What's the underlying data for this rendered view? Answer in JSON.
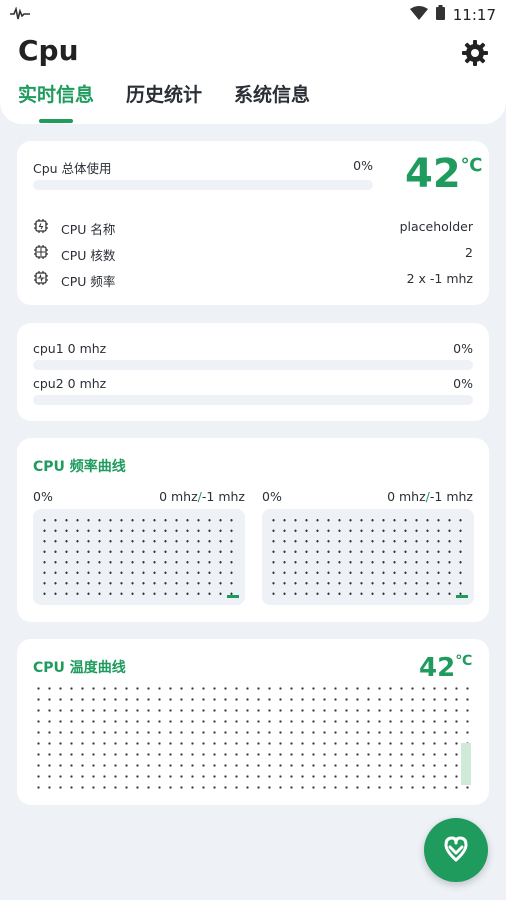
{
  "status_bar": {
    "time": "11:17"
  },
  "app": {
    "title": "Cpu"
  },
  "tabs": [
    {
      "label": "实时信息",
      "active": true
    },
    {
      "label": "历史统计",
      "active": false
    },
    {
      "label": "系统信息",
      "active": false
    }
  ],
  "summary": {
    "total_label": "Cpu 总体使用",
    "total_percent": "0%",
    "temperature_value": "42",
    "temperature_unit": "℃",
    "rows": [
      {
        "icon": "cpu-chip-icon",
        "label": "CPU 名称",
        "value": "placeholder"
      },
      {
        "icon": "cpu-grid-icon",
        "label": "CPU 核数",
        "value": "2"
      },
      {
        "icon": "cpu-frequency-icon",
        "label": "CPU 频率",
        "value": "2 x -1 mhz"
      }
    ]
  },
  "cores": [
    {
      "label": "cpu1  0 mhz",
      "percent": "0%"
    },
    {
      "label": "cpu2  0 mhz",
      "percent": "0%"
    }
  ],
  "freq_curve": {
    "title": "CPU 频率曲线",
    "panels": [
      {
        "percent": "0%",
        "freq_current": "0 mhz",
        "freq_max": "-1 mhz"
      },
      {
        "percent": "0%",
        "freq_current": "0 mhz",
        "freq_max": "-1 mhz"
      }
    ]
  },
  "temp_curve": {
    "title": "CPU 温度曲线",
    "temperature_value": "42",
    "temperature_unit": "℃"
  },
  "colors": {
    "accent": "#1e9b5d",
    "background": "#eef2f7",
    "card": "#ffffff"
  },
  "fab": {
    "icon": "chevron-down-heart-icon"
  }
}
